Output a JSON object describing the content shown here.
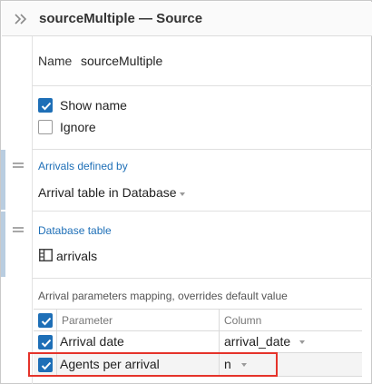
{
  "header": {
    "title": "sourceMultiple — Source"
  },
  "name_field": {
    "label": "Name",
    "value": "sourceMultiple"
  },
  "options": {
    "show_name": {
      "label": "Show name",
      "checked": true
    },
    "ignore": {
      "label": "Ignore",
      "checked": false
    }
  },
  "arrivals": {
    "section_title": "Arrivals defined by",
    "selected": "Arrival table in Database"
  },
  "database_table": {
    "section_title": "Database table",
    "value": "arrivals"
  },
  "mapping": {
    "caption": "Arrival parameters mapping, overrides default value",
    "columns": [
      "Parameter",
      "Column"
    ],
    "rows": [
      {
        "checked": true,
        "parameter": "Arrival date",
        "column": "arrival_date"
      },
      {
        "checked": true,
        "parameter": "Agents per arrival",
        "column": "n"
      }
    ]
  },
  "colors": {
    "accent": "#1e6fb7",
    "highlight": "#e5332a"
  },
  "icons": [
    "chevron-double-right-icon",
    "checkbox-icon",
    "drag-handle-icon",
    "table-icon",
    "caret-down-icon"
  ]
}
